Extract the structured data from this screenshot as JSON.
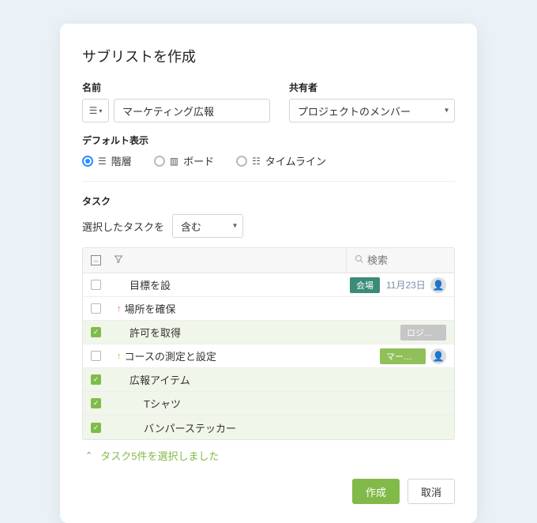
{
  "modal": {
    "title": "サブリストを作成",
    "name_label": "名前",
    "name_value": "マーケティング広報",
    "sharer_label": "共有者",
    "sharer_value": "プロジェクトのメンバー",
    "default_view_label": "デフォルト表示",
    "views": {
      "hierarchy": "階層",
      "board": "ボード",
      "timeline": "タイムライン"
    },
    "tasks_label": "タスク",
    "include_prefix": "選択したタスクを",
    "include_value": "含む",
    "search_placeholder": "検索"
  },
  "tasks": [
    {
      "checked": false,
      "name": "目標を設",
      "indent": 0,
      "priority": null,
      "tag": {
        "text": "会場",
        "color": "teal"
      },
      "date": "11月23日",
      "avatar": true
    },
    {
      "checked": false,
      "name": "場所を確保",
      "indent": 0,
      "priority": "high",
      "tag": null,
      "date": null,
      "avatar": false
    },
    {
      "checked": true,
      "name": "許可を取得",
      "indent": 0,
      "priority": null,
      "tag": {
        "text": "ロジス…",
        "color": "grey"
      },
      "date": null,
      "avatar": false
    },
    {
      "checked": false,
      "name": "コースの測定と設定",
      "indent": 0,
      "priority": "med",
      "tag": {
        "text": "マーケ…",
        "color": "green"
      },
      "date": null,
      "avatar": true
    },
    {
      "checked": true,
      "name": "広報アイテム",
      "indent": 0,
      "priority": null,
      "tag": null,
      "date": null,
      "avatar": false
    },
    {
      "checked": true,
      "name": "Tシャツ",
      "indent": 1,
      "priority": null,
      "tag": null,
      "date": null,
      "avatar": false
    },
    {
      "checked": true,
      "name": "バンパーステッカー",
      "indent": 1,
      "priority": null,
      "tag": null,
      "date": null,
      "avatar": false
    }
  ],
  "summary": {
    "text": "タスク5件を選択しました"
  },
  "footer": {
    "create": "作成",
    "cancel": "取消"
  }
}
